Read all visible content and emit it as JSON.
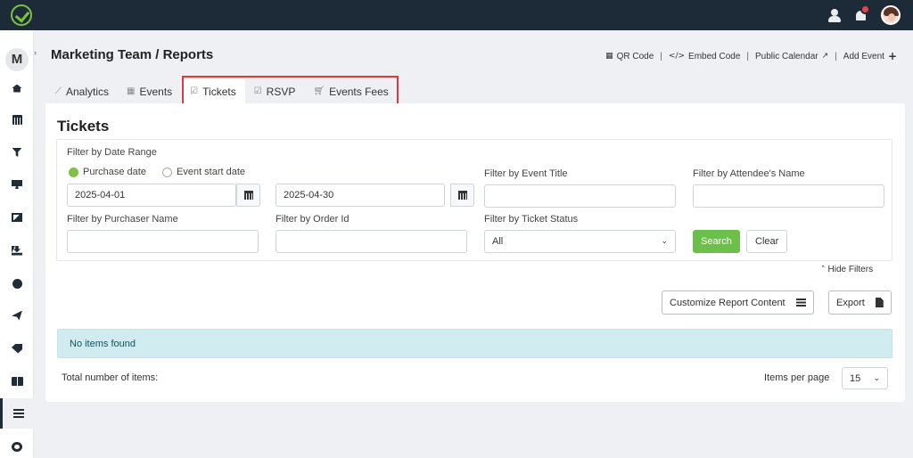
{
  "topbar": {
    "icons": [
      "logo-icon",
      "support-agent-icon",
      "notification-bell-icon",
      "user-avatar-icon"
    ],
    "brand_color": "#7dc242",
    "notification_color": "#e0474c",
    "bar_color": "#1c2b37"
  },
  "sidebar": {
    "avatar_letter": "M",
    "toggle": "›",
    "items": [
      {
        "icon": "home-icon"
      },
      {
        "icon": "calendar-icon"
      },
      {
        "icon": "filter-icon"
      },
      {
        "icon": "monitor-icon"
      },
      {
        "icon": "image-icon"
      },
      {
        "icon": "download-icon"
      },
      {
        "icon": "globe-icon"
      },
      {
        "icon": "send-icon"
      },
      {
        "icon": "tags-icon"
      },
      {
        "icon": "id-card-icon"
      },
      {
        "icon": "list-icon",
        "active": true
      },
      {
        "icon": "settings-gears-icon"
      }
    ]
  },
  "header": {
    "title": "Marketing Team / Reports",
    "actions": [
      {
        "label": "QR Code",
        "icon": "qrcode-icon"
      },
      {
        "label": "Embed Code",
        "icon": "code-icon"
      },
      {
        "label": "Public Calendar",
        "icon": "external-link-icon"
      },
      {
        "label": "Add Event",
        "icon": "plus-icon"
      }
    ]
  },
  "tabs": [
    {
      "label": "Analytics",
      "icon": "line-chart-icon"
    },
    {
      "label": "Events",
      "icon": "calendar-icon"
    },
    {
      "label": "Tickets",
      "icon": "check-square-icon",
      "active": true
    },
    {
      "label": "RSVP",
      "icon": "check-square-icon"
    },
    {
      "label": "Events Fees",
      "icon": "cart-icon"
    }
  ],
  "highlight_color": "#e0383e",
  "panel": {
    "title": "Tickets",
    "filters": {
      "date_range_label": "Filter by Date Range",
      "radio_purchase": "Purchase date",
      "radio_event_start": "Event start date",
      "radio_selected": "Purchase date",
      "date_from": "2025-04-01",
      "date_to": "2025-04-30",
      "event_title_label": "Filter by Event Title",
      "event_title_value": "",
      "attendee_label": "Filter by Attendee's Name",
      "attendee_value": "",
      "purchaser_label": "Filter by Purchaser Name",
      "purchaser_value": "",
      "order_label": "Filter by Order Id",
      "order_value": "",
      "status_label": "Filter by Ticket Status",
      "status_value": "All",
      "search_label": "Search",
      "clear_label": "Clear",
      "hide_filters_label": "Hide Filters",
      "search_color": "#6cbf4a"
    },
    "customize_label": "Customize Report Content",
    "export_label": "Export",
    "empty_message": "No items found",
    "total_label": "Total number of items:",
    "items_per_page_label": "Items per page",
    "items_per_page_value": "15"
  }
}
